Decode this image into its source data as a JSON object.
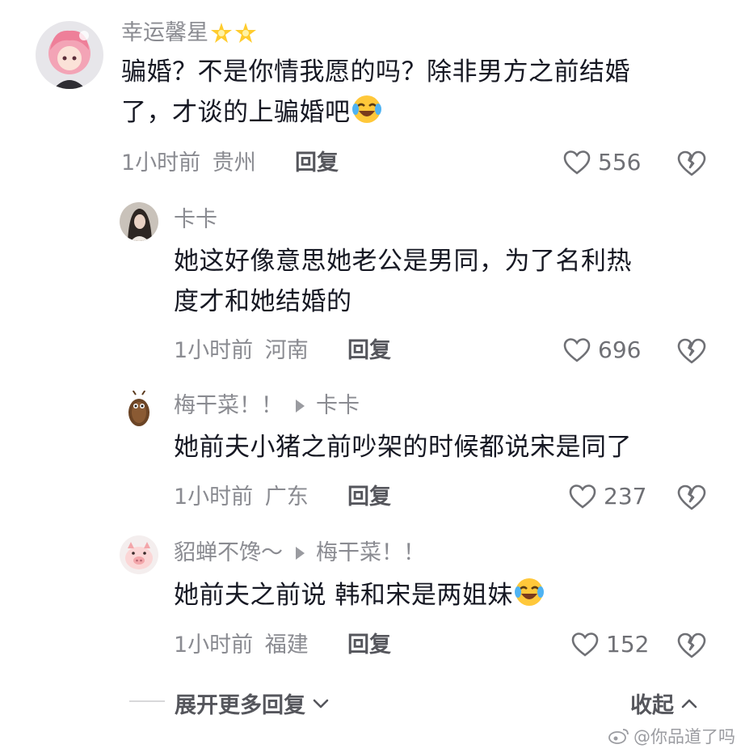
{
  "comments": [
    {
      "username": "幸运馨星",
      "user_emoji": [
        "star-emoji",
        "star-emoji"
      ],
      "text_line1": "骗婚？不是你情我愿的吗？除非男方之前结婚",
      "text_line2": "了，才谈的上骗婚吧",
      "text_emoji": "laugh-cry-emoji",
      "time": "1小时前",
      "location": "贵州",
      "reply_label": "回复",
      "likes": "556"
    },
    {
      "username": "卡卡",
      "text_line1": "她这好像意思她老公是男同，为了名利热",
      "text_line2": "度才和她结婚的",
      "time": "1小时前",
      "location": "河南",
      "reply_label": "回复",
      "likes": "696"
    },
    {
      "username": "梅干菜！！",
      "reply_to": "卡卡",
      "text_line1": "她前夫小猪之前吵架的时候都说宋是同了",
      "time": "1小时前",
      "location": "广东",
      "reply_label": "回复",
      "likes": "237"
    },
    {
      "username": "貂蝉不馋～",
      "reply_to": "梅干菜！！",
      "text_line1": "她前夫之前说 韩和宋是两姐妹",
      "text_emoji": "laugh-cry-emoji",
      "time": "1小时前",
      "location": "福建",
      "reply_label": "回复",
      "likes": "152"
    }
  ],
  "footer": {
    "expand_label": "展开更多回复",
    "collapse_label": "收起"
  },
  "watermark": {
    "text": "@你品道了吗"
  },
  "colors": {
    "text_primary": "#161823",
    "text_secondary": "#8a8b91",
    "action": "#55565c"
  }
}
